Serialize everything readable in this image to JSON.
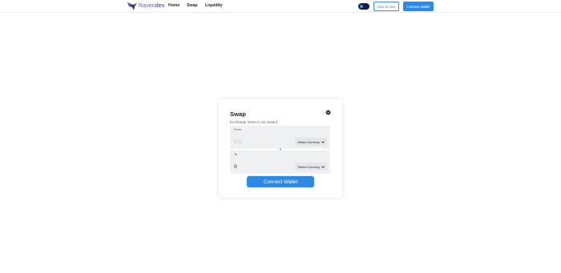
{
  "brand": {
    "name_part1": "Raven",
    "name_part2": "dex",
    "logo_icon": "bird-logo-icon"
  },
  "nav": {
    "links": [
      {
        "label": "Home"
      },
      {
        "label": "Swap"
      },
      {
        "label": "Liquidity"
      }
    ],
    "theme_toggle_icon": "toggle-switch-icon",
    "how_to_use_label": "How to Use",
    "connect_wallet_label": "Connect Wallet"
  },
  "swap": {
    "title": "Swap",
    "subtitle": "Exchange token in an instant",
    "settings_icon": "gear-icon",
    "from": {
      "label": "From",
      "placeholder": "0.0",
      "currency_label": "Select Currency"
    },
    "switch_icon": "arrow-down-icon",
    "to": {
      "label": "To",
      "value": "0",
      "currency_label": "Select Currency"
    },
    "connect_wallet_label": "Connect Wallet"
  },
  "colors": {
    "accent": "#2e89e2",
    "brand_purple": "#3a2a7a",
    "toggle_bg": "#0d1f4a"
  }
}
